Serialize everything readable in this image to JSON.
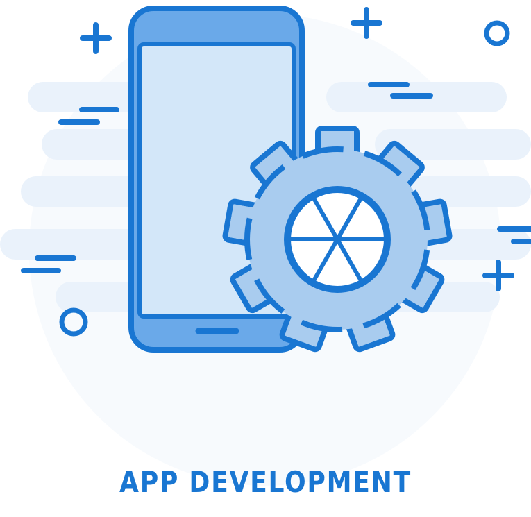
{
  "title": "APP DEVELOPMENT",
  "colors": {
    "outline": "#1976d2",
    "phone_body": "#d3e7f9",
    "phone_bezel": "#6aa9e9",
    "gear_fill": "#a9ccef",
    "cloud": "#eef4fb",
    "background": "#ffffff"
  },
  "icons": {
    "phone": "smartphone-icon",
    "gear": "gear-icon",
    "sparkle": "plus-sparkle-icon",
    "ring": "ring-icon"
  }
}
